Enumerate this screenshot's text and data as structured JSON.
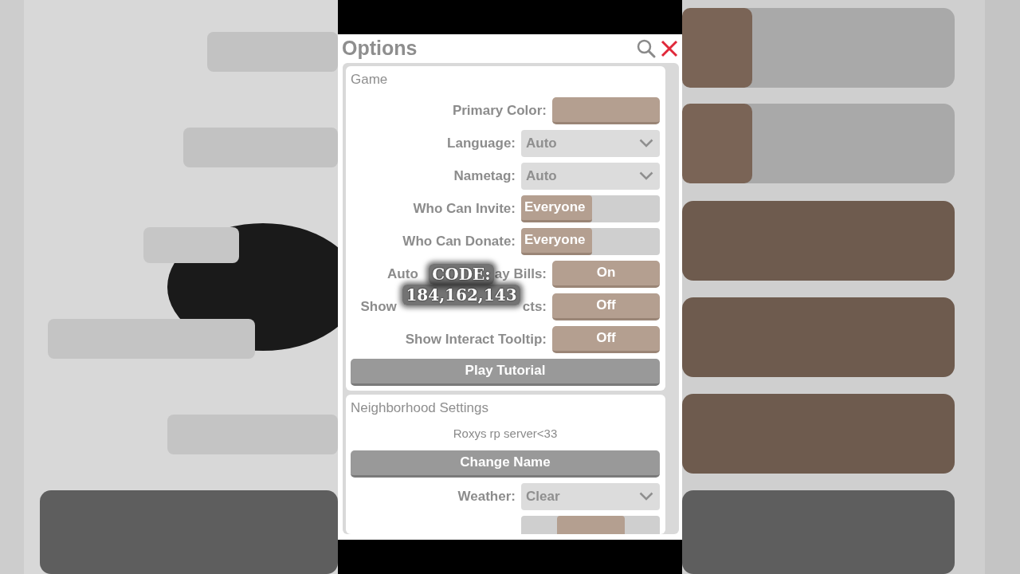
{
  "window": {
    "title": "Options"
  },
  "sections": [
    {
      "title": "Game",
      "rows": [
        {
          "kind": "color",
          "label_parts": [
            "Primary Color:"
          ],
          "color": "#b49f90"
        },
        {
          "kind": "dropdown",
          "label_parts": [
            "Language:"
          ],
          "value": "Auto"
        },
        {
          "kind": "dropdown",
          "label_parts": [
            "Nametag:"
          ],
          "value": "Auto"
        },
        {
          "kind": "slider",
          "label_parts": [
            "Who Can Invite:"
          ],
          "value": "Everyone",
          "level": 0.51
        },
        {
          "kind": "slider",
          "label_parts": [
            "Who Can Donate:"
          ],
          "value": "Everyone",
          "level": 0.51
        },
        {
          "kind": "toggle",
          "label_parts": [
            "Auto",
            "ay Bills:"
          ],
          "value": "On"
        },
        {
          "kind": "toggle",
          "label_parts": [
            "Show",
            "cts:"
          ],
          "value": "Off"
        },
        {
          "kind": "toggle",
          "label_parts": [
            "Show Interact Tooltip:"
          ],
          "value": "Off"
        },
        {
          "kind": "button",
          "label": "Play Tutorial"
        }
      ]
    },
    {
      "title": "Neighborhood Settings",
      "rows": [
        {
          "kind": "text",
          "label": "Roxys rp server<33"
        },
        {
          "kind": "button",
          "label": "Change Name"
        },
        {
          "kind": "dropdown",
          "label_parts": [
            "Weather:"
          ],
          "value": "Clear"
        },
        {
          "kind": "cut"
        }
      ]
    }
  ],
  "overlay": {
    "lines": [
      "CODE:",
      "184,162,143"
    ]
  }
}
